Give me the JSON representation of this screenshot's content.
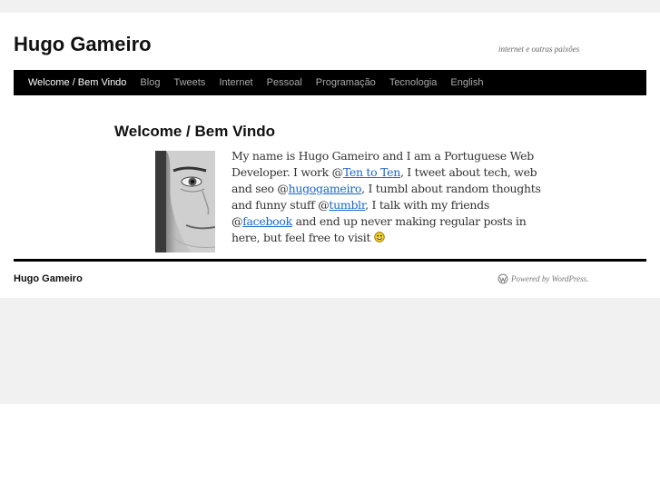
{
  "site": {
    "title": "Hugo Gameiro",
    "tagline": "internet e outras paixões"
  },
  "nav": {
    "items": [
      {
        "label": "Welcome / Bem Vindo",
        "active": true
      },
      {
        "label": "Blog"
      },
      {
        "label": "Tweets"
      },
      {
        "label": "Internet"
      },
      {
        "label": "Pessoal"
      },
      {
        "label": "Programação"
      },
      {
        "label": "Tecnologia"
      },
      {
        "label": "English"
      }
    ]
  },
  "post": {
    "title": "Welcome / Bem Vindo",
    "avatar_icon": "face-photo",
    "body": {
      "p1": "My name is Hugo Gameiro and I am a Portuguese Web Developer. I work @",
      "link_tenten": "Ten to Ten",
      "p2": ", I tweet about tech, web and seo @",
      "link_twitter": "hugogameiro",
      "p3": ", I tumbl about random thoughts and funny stuff @",
      "link_tumblr": "tumblr",
      "p4": ", I talk with my friends @",
      "link_facebook": "facebook",
      "p5": " and end up never making regular posts in here, but feel free to visit ",
      "emoji_icon": "smiley-icon"
    }
  },
  "footer": {
    "title": "Hugo Gameiro",
    "powered_by": "Powered by WordPress.",
    "wordpress_icon": "wordpress-icon"
  },
  "colors": {
    "nav_bg": "#000000",
    "link": "#1a66cc",
    "outer_bg": "#f1f1f1"
  }
}
